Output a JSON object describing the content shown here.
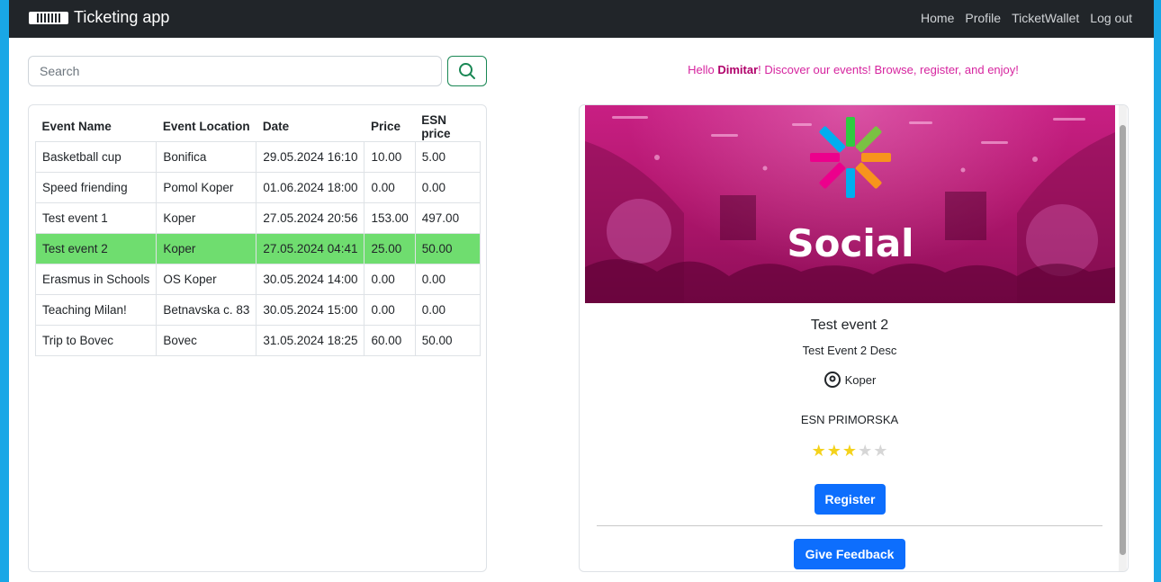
{
  "navbar": {
    "brand": "Ticketing app",
    "links": [
      "Home",
      "Profile",
      "TicketWallet",
      "Log out"
    ]
  },
  "search": {
    "placeholder": "Search"
  },
  "table": {
    "headers": [
      "Event Name",
      "Event Location",
      "Date",
      "Price",
      "ESN price"
    ],
    "rows": [
      [
        "Basketball cup",
        "Bonifica",
        "29.05.2024 16:10",
        "10.00",
        "5.00"
      ],
      [
        "Speed friending",
        "Pomol Koper",
        "01.06.2024 18:00",
        "0.00",
        "0.00"
      ],
      [
        "Test event 1",
        "Koper",
        "27.05.2024 20:56",
        "153.00",
        "497.00"
      ],
      [
        "Test event 2",
        "Koper",
        "27.05.2024 04:41",
        "25.00",
        "50.00"
      ],
      [
        "Erasmus in Schools",
        "OS Koper",
        "30.05.2024 14:00",
        "0.00",
        "0.00"
      ],
      [
        "Teaching Milan!",
        "Betnavska c. 83",
        "30.05.2024 15:00",
        "0.00",
        "0.00"
      ],
      [
        "Trip to Bovec",
        "Bovec",
        "31.05.2024 18:25",
        "60.00",
        "50.00"
      ]
    ],
    "selected_row": 3,
    "selected_color": "#6fdd6f"
  },
  "greeting": {
    "prefix": "Hello ",
    "name": "Dimitar",
    "suffix": "! Discover our events! Browse, register, and enjoy!"
  },
  "event": {
    "image_text": "Social",
    "title": "Test event 2",
    "description": "Test Event 2 Desc",
    "location": "Koper",
    "organizer": "ESN PRIMORSKA",
    "rating": 3,
    "rating_max": 5,
    "register_label": "Register",
    "feedback_label": "Give Feedback"
  },
  "icons": {
    "search": "search-icon",
    "location": "map-pin-icon",
    "brand": "ticket-icon"
  },
  "colors": {
    "accent": "#0d6efd",
    "greeting": "#d6249f",
    "search_border": "#198754",
    "navbar": "#212529"
  }
}
